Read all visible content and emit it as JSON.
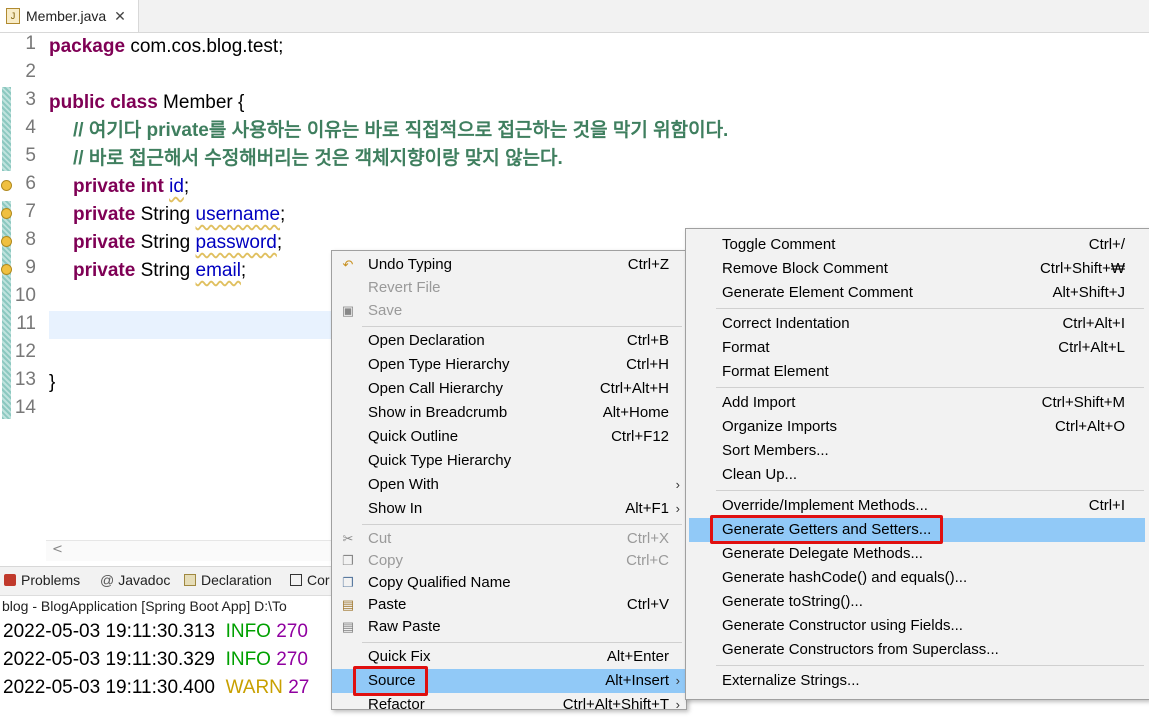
{
  "tab": {
    "title": "Member.java",
    "close": "✕",
    "icon": "J"
  },
  "code": {
    "line1": {
      "kw": "package",
      "rest": " com.cos.blog.test;"
    },
    "line3": {
      "kw": "public class",
      "rest": " Member {"
    },
    "line4": "// 여기다 private를 사용하는 이유는 바로 직접적으로 접근하는 것을 막기 위함이다.",
    "line5": "// 바로 접근해서 수정해버리는 것은 객체지향이랑 맞지 않는다.",
    "line6": {
      "kw": "private int",
      "field": "id",
      "end": ";"
    },
    "line7": {
      "kw": "private",
      "type": " String ",
      "field": "username",
      "end": ";"
    },
    "line8": {
      "kw": "private",
      "type": " String ",
      "field": "password",
      "end": ";"
    },
    "line9": {
      "kw": "private",
      "type": " String ",
      "field": "email",
      "end": ";"
    },
    "line13": "}",
    "line_numbers": [
      "1",
      "2",
      "3",
      "4",
      "5",
      "6",
      "7",
      "8",
      "9",
      "10",
      "11",
      "12",
      "13",
      "14"
    ]
  },
  "bottom": {
    "tabs": [
      "Problems",
      "Javadoc",
      "Declaration",
      "Cor"
    ],
    "status": "blog - BlogApplication [Spring Boot App] D:\\To",
    "logs": [
      {
        "ts": "2022-05-03 19:11:30.313",
        "lvl": "INFO",
        "pid": "270"
      },
      {
        "ts": "2022-05-03 19:11:30.329",
        "lvl": "INFO",
        "pid": "270"
      },
      {
        "ts": "2022-05-03 19:11:30.400",
        "lvl": "WARN",
        "pid": "27"
      }
    ]
  },
  "menu": {
    "items": [
      {
        "label": "Undo Typing",
        "acc": "Ctrl+Z"
      },
      {
        "label": "Revert File",
        "acc": ""
      },
      {
        "label": "Save",
        "acc": ""
      },
      {
        "label": "Open Declaration",
        "acc": "Ctrl+B"
      },
      {
        "label": "Open Type Hierarchy",
        "acc": "Ctrl+H"
      },
      {
        "label": "Open Call Hierarchy",
        "acc": "Ctrl+Alt+H"
      },
      {
        "label": "Show in Breadcrumb",
        "acc": "Alt+Home"
      },
      {
        "label": "Quick Outline",
        "acc": "Ctrl+F12"
      },
      {
        "label": "Quick Type Hierarchy",
        "acc": ""
      },
      {
        "label": "Open With",
        "acc": ""
      },
      {
        "label": "Show In",
        "acc": "Alt+F1"
      },
      {
        "label": "Cut",
        "acc": "Ctrl+X"
      },
      {
        "label": "Copy",
        "acc": "Ctrl+C"
      },
      {
        "label": "Copy Qualified Name",
        "acc": ""
      },
      {
        "label": "Paste",
        "acc": "Ctrl+V"
      },
      {
        "label": "Raw Paste",
        "acc": ""
      },
      {
        "label": "Quick Fix",
        "acc": "Alt+Enter"
      },
      {
        "label": "Source",
        "acc": "Alt+Insert"
      },
      {
        "label": "Refactor",
        "acc": "Ctrl+Alt+Shift+T"
      }
    ]
  },
  "submenu": {
    "items": [
      {
        "label": "Toggle Comment",
        "acc": "Ctrl+/"
      },
      {
        "label": "Remove Block Comment",
        "acc": "Ctrl+Shift+₩"
      },
      {
        "label": "Generate Element Comment",
        "acc": "Alt+Shift+J"
      },
      {
        "label": "Correct Indentation",
        "acc": "Ctrl+Alt+I"
      },
      {
        "label": "Format",
        "acc": "Ctrl+Alt+L"
      },
      {
        "label": "Format Element",
        "acc": ""
      },
      {
        "label": "Add Import",
        "acc": "Ctrl+Shift+M"
      },
      {
        "label": "Organize Imports",
        "acc": "Ctrl+Alt+O"
      },
      {
        "label": "Sort Members...",
        "acc": ""
      },
      {
        "label": "Clean Up...",
        "acc": ""
      },
      {
        "label": "Override/Implement Methods...",
        "acc": "Ctrl+I"
      },
      {
        "label": "Generate Getters and Setters...",
        "acc": ""
      },
      {
        "label": "Generate Delegate Methods...",
        "acc": ""
      },
      {
        "label": "Generate hashCode() and equals()...",
        "acc": ""
      },
      {
        "label": "Generate toString()...",
        "acc": ""
      },
      {
        "label": "Generate Constructor using Fields...",
        "acc": ""
      },
      {
        "label": "Generate Constructors from Superclass...",
        "acc": ""
      },
      {
        "label": "Externalize Strings...",
        "acc": ""
      }
    ]
  },
  "colors": {
    "highlight": "#91c9f7",
    "redbox": "#e01010",
    "keyword": "#7f0055",
    "comment": "#3f7f5f",
    "field": "#0000c0"
  }
}
